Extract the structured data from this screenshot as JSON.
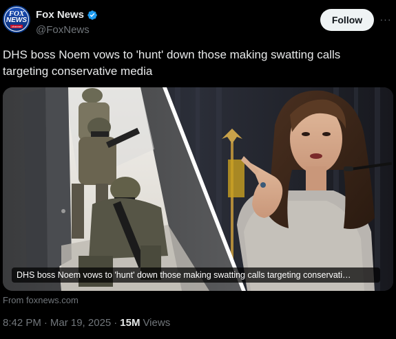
{
  "author": {
    "avatar_text_1": "FOX",
    "avatar_text_2": "NEWS",
    "avatar_text_3": "channel",
    "display_name": "Fox News",
    "handle": "@FoxNews",
    "verified_icon": "verified-badge-icon",
    "verified_color": "#1d9bf0"
  },
  "actions": {
    "follow_label": "Follow",
    "more_label": "···"
  },
  "post": {
    "text": "DHS boss Noem vows to 'hunt' down those making swatting calls targeting conservative media"
  },
  "media": {
    "caption": "DHS boss Noem vows to 'hunt' down those making swatting calls targeting conservati…",
    "source": "From foxnews.com"
  },
  "meta": {
    "time": "8:42 PM",
    "date": "Mar 19, 2025",
    "views_count": "15M",
    "views_label": "Views",
    "separator": "·"
  }
}
